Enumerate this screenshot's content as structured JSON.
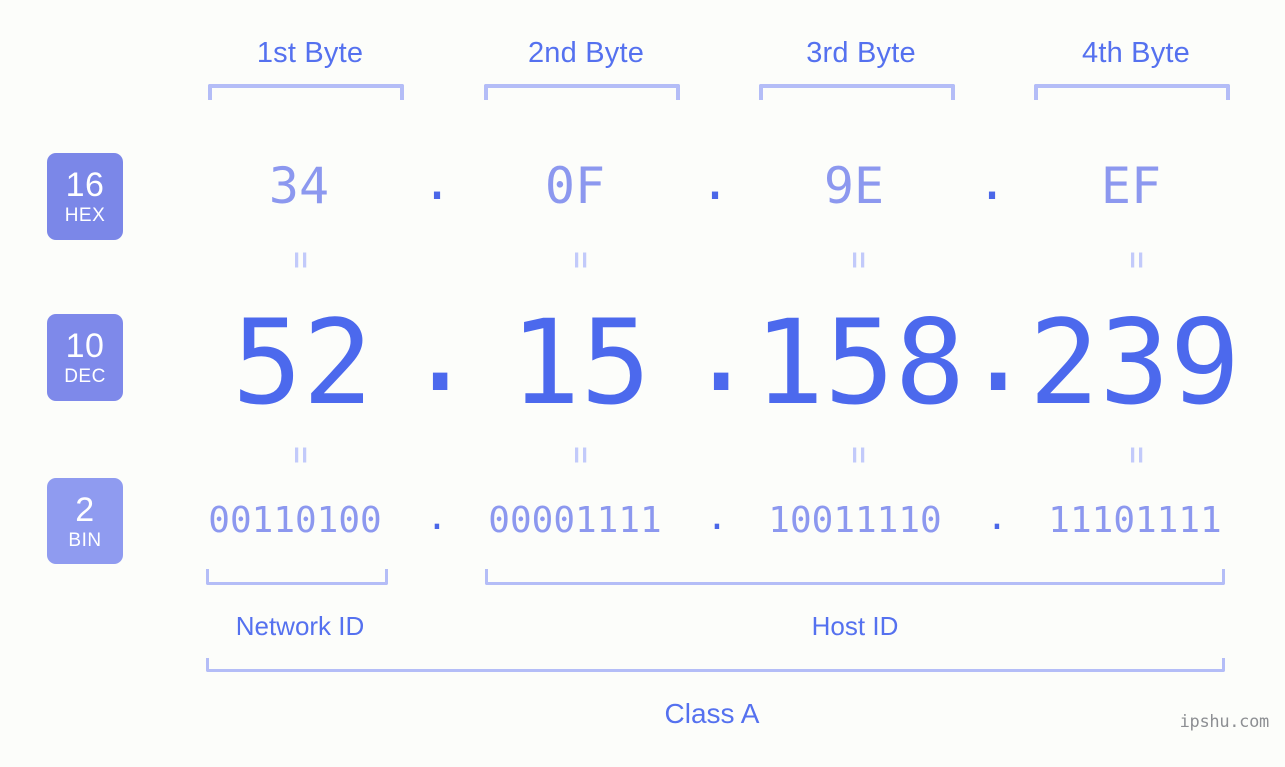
{
  "page": {
    "background_color": "#fcfdfa",
    "accent_color": "#4c69ed",
    "light_accent_color": "#8c98ef",
    "bracket_color": "#b4bdf7",
    "watermark": "ipshu.com"
  },
  "byte_headers": [
    {
      "label": "1st Byte"
    },
    {
      "label": "2nd Byte"
    },
    {
      "label": "3rd Byte"
    },
    {
      "label": "4th Byte"
    }
  ],
  "bases": [
    {
      "number": "16",
      "abbr": "HEX",
      "color": "#7b87e8"
    },
    {
      "number": "10",
      "abbr": "DEC",
      "color": "#7e89ea"
    },
    {
      "number": "2",
      "abbr": "BIN",
      "color": "#8f9bf0"
    }
  ],
  "rows": {
    "hex": {
      "values": [
        "34",
        "0F",
        "9E",
        "EF"
      ],
      "separator": "."
    },
    "dec": {
      "values": [
        "52",
        "15",
        "158",
        "239"
      ],
      "separator": "."
    },
    "bin": {
      "values": [
        "00110100",
        "00001111",
        "10011110",
        "11101111"
      ],
      "separator": "."
    }
  },
  "equivalence_markers": [
    "=",
    "=",
    "=",
    "=",
    "=",
    "=",
    "=",
    "="
  ],
  "id_sections": [
    {
      "label": "Network ID"
    },
    {
      "label": "Host ID"
    }
  ],
  "class": {
    "label": "Class A"
  }
}
